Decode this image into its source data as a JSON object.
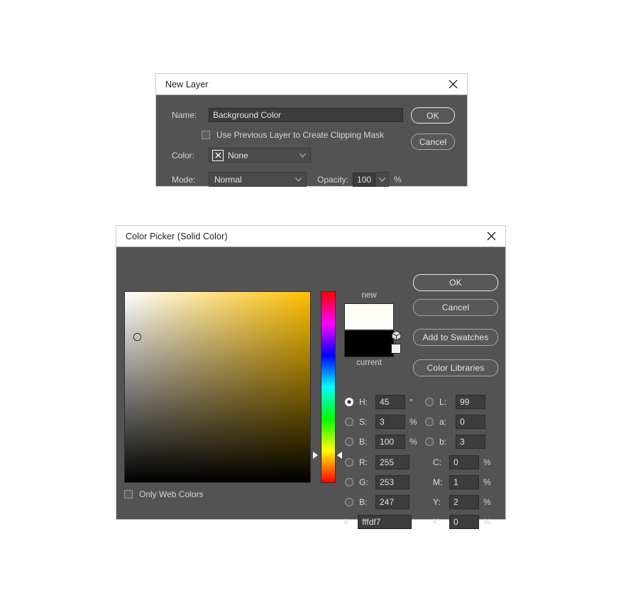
{
  "new_layer_dialog": {
    "title": "New Layer",
    "close_icon": "close-icon",
    "name_label": "Name:",
    "name_value": "Background Color",
    "clipping_mask_label": "Use Previous Layer to Create Clipping Mask",
    "clipping_mask_checked": false,
    "color_label": "Color:",
    "color_value": "None",
    "color_swatch_icon": "none-x-icon",
    "mode_label": "Mode:",
    "mode_value": "Normal",
    "opacity_label": "Opacity:",
    "opacity_value": "100",
    "opacity_unit": "%",
    "ok_label": "OK",
    "cancel_label": "Cancel"
  },
  "color_picker_dialog": {
    "title": "Color Picker (Solid Color)",
    "close_icon": "close-icon",
    "ok_label": "OK",
    "cancel_label": "Cancel",
    "add_to_swatches_label": "Add to Swatches",
    "color_libraries_label": "Color Libraries",
    "new_label": "new",
    "current_label": "current",
    "new_color": "#fffdf7",
    "current_color": "#000000",
    "gamut_warning_icon": "cube-icon",
    "web_safe_icon": "web-safe-square-icon",
    "only_web_colors_label": "Only Web Colors",
    "only_web_colors_checked": false,
    "selected_channel": "H",
    "hex_symbol": "#",
    "hex_value": "fffdf7",
    "hsb": [
      {
        "key": "H",
        "label": "H:",
        "value": "45",
        "unit": "°",
        "selected": true
      },
      {
        "key": "S",
        "label": "S:",
        "value": "3",
        "unit": "%",
        "selected": false
      },
      {
        "key": "B",
        "label": "B:",
        "value": "100",
        "unit": "%",
        "selected": false
      }
    ],
    "lab": [
      {
        "key": "L",
        "label": "L:",
        "value": "99",
        "unit": "",
        "selected": false
      },
      {
        "key": "a",
        "label": "a:",
        "value": "0",
        "unit": "",
        "selected": false
      },
      {
        "key": "b",
        "label": "b:",
        "value": "3",
        "unit": "",
        "selected": false
      }
    ],
    "rgb": [
      {
        "key": "R",
        "label": "R:",
        "value": "255",
        "unit": "",
        "selected": false
      },
      {
        "key": "G",
        "label": "G:",
        "value": "253",
        "unit": "",
        "selected": false
      },
      {
        "key": "B",
        "label": "B:",
        "value": "247",
        "unit": "",
        "selected": false
      }
    ],
    "cmyk": [
      {
        "key": "C",
        "label": "C:",
        "value": "0",
        "unit": "%"
      },
      {
        "key": "M",
        "label": "M:",
        "value": "1",
        "unit": "%"
      },
      {
        "key": "Y",
        "label": "Y:",
        "value": "2",
        "unit": "%"
      },
      {
        "key": "K",
        "label": "K:",
        "value": "0",
        "unit": "%"
      }
    ]
  }
}
